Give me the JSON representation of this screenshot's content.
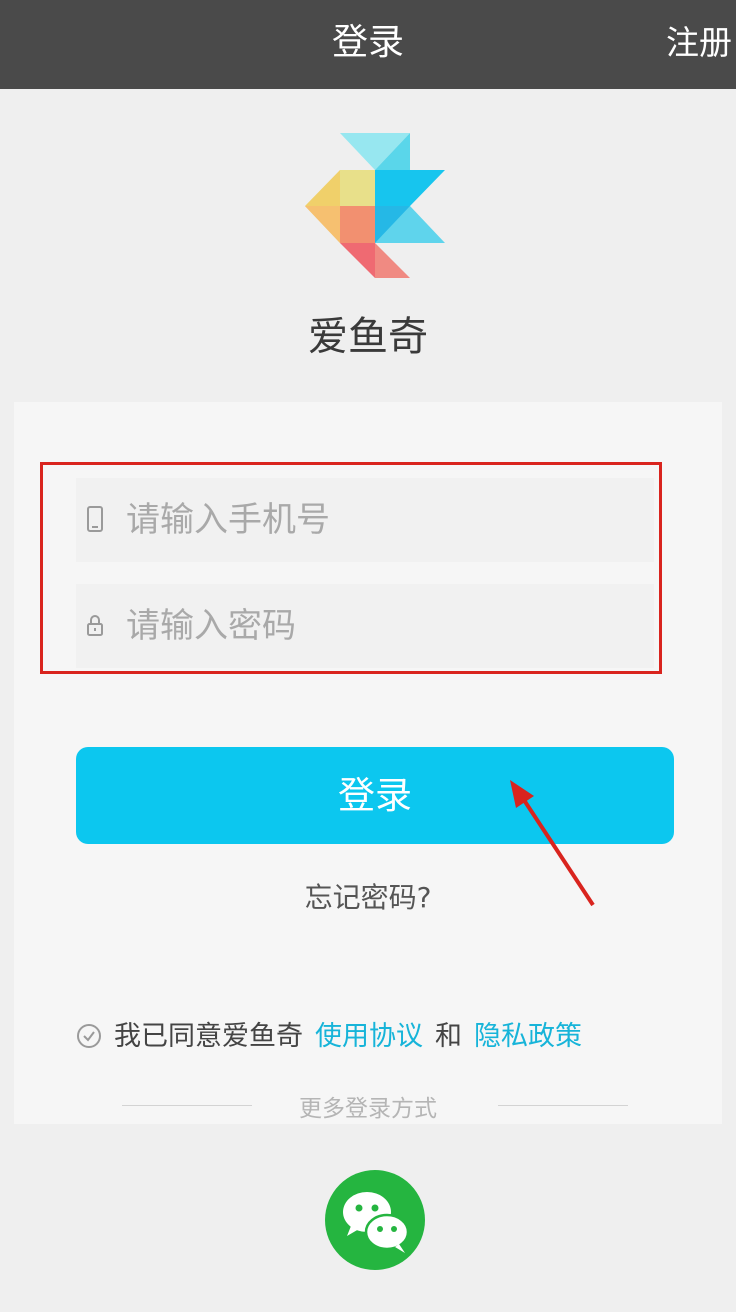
{
  "header": {
    "title": "登录",
    "register_label": "注册"
  },
  "app": {
    "name": "爱鱼奇"
  },
  "form": {
    "phone_placeholder": "请输入手机号",
    "password_placeholder": "请输入密码",
    "login_label": "登录",
    "forgot_label": "忘记密码?"
  },
  "agreement": {
    "prefix": "我已同意爱鱼奇",
    "terms_link": "使用协议",
    "conjunction": "和",
    "privacy_link": "隐私政策"
  },
  "more_login": {
    "label": "更多登录方式"
  },
  "colors": {
    "header_bg": "#4a4a4a",
    "accent": "#0cc7ef",
    "link": "#17b4d9",
    "wechat": "#25b540",
    "annotation": "#d9241e"
  },
  "icons": {
    "phone": "phone-icon",
    "lock": "lock-icon",
    "check": "check-circle-icon",
    "wechat": "wechat-icon"
  }
}
